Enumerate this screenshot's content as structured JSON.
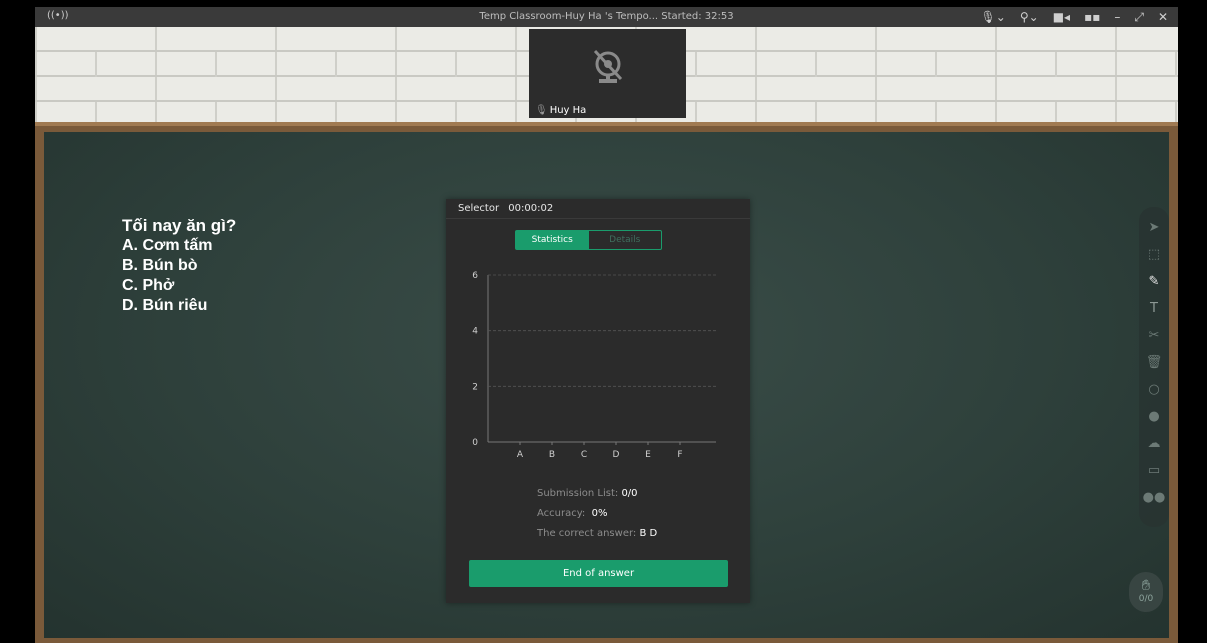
{
  "titlebar": {
    "live_icon": "((•))",
    "title": "Temp Classroom-Huy Ha 's Tempo...  Started: 32:53",
    "controls": [
      "mic-icon",
      "camera-icon",
      "video-icon",
      "layout-icon",
      "minimize-icon",
      "expand-icon",
      "close-icon"
    ]
  },
  "video": {
    "name": "Huy Ha"
  },
  "question": {
    "text": "Tối nay ăn gì?",
    "options": [
      "A. Cơm tấm",
      "B. Bún bò",
      "C. Phở",
      "D. Bún riêu"
    ]
  },
  "panel": {
    "title": "Selector",
    "timer": "00:00:02",
    "tabs": [
      "Statistics",
      "Details"
    ],
    "submission_label": "Submission List:",
    "submission_value": "0/0",
    "accuracy_label": "Accuracy:",
    "accuracy_value": "0%",
    "correct_label": "The correct answer:",
    "correct_value": "B D",
    "end_button": "End of answer"
  },
  "chart_data": {
    "type": "bar",
    "categories": [
      "A",
      "B",
      "C",
      "D",
      "E",
      "F"
    ],
    "values": [
      0,
      0,
      0,
      0,
      0,
      0
    ],
    "ylim": [
      0,
      6
    ],
    "yticks": [
      0,
      2,
      4,
      6
    ],
    "grid": true
  },
  "toolbar": {
    "tools": [
      "pointer-icon",
      "select-icon",
      "pen-icon",
      "text-icon",
      "eraser-icon",
      "delete-icon",
      "shape-icon",
      "chat-icon",
      "cloud-icon",
      "toolbox-icon",
      "users-icon"
    ]
  },
  "hand": {
    "count": "0/0"
  }
}
